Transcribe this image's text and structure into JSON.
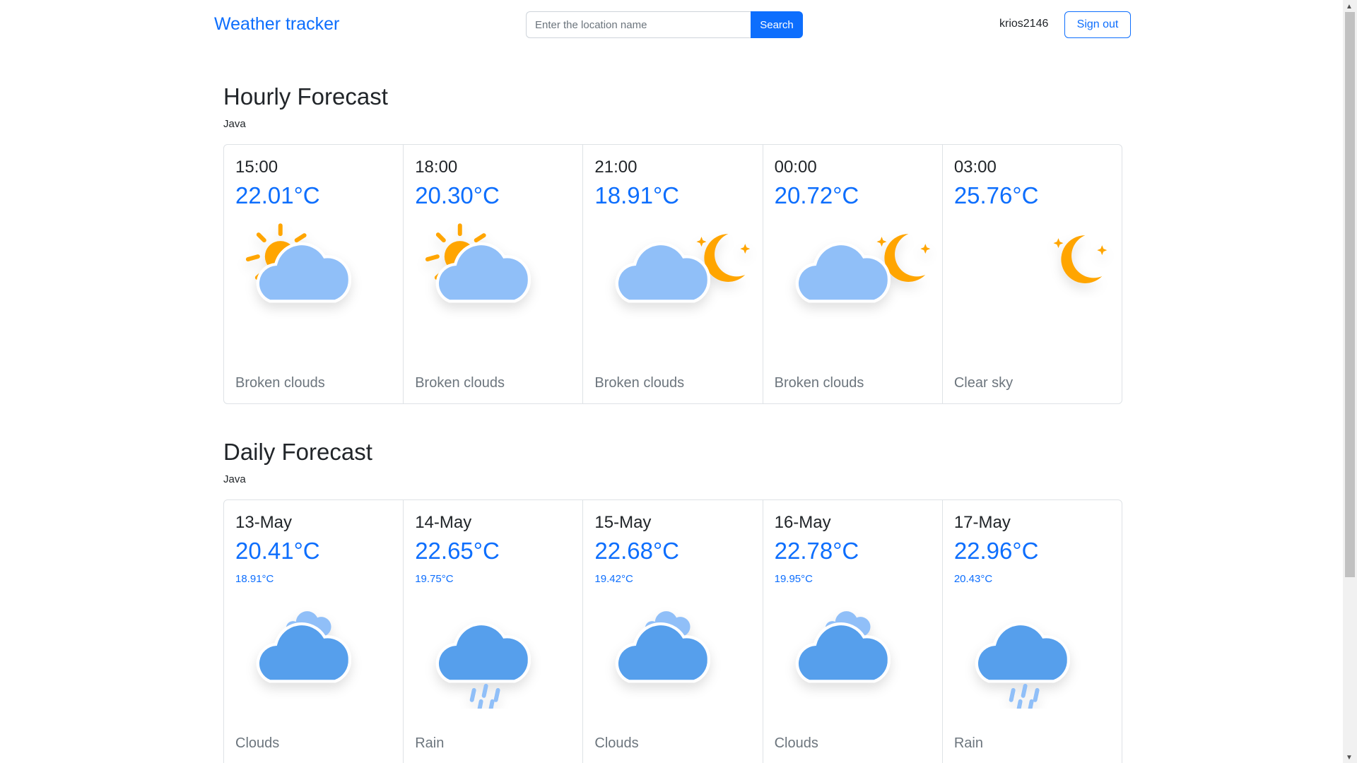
{
  "navbar": {
    "brand": "Weather tracker",
    "search_placeholder": "Enter the location name",
    "search_button": "Search",
    "username": "krios2146",
    "signout_button": "Sign out"
  },
  "hourly": {
    "title": "Hourly Forecast",
    "location": "Java",
    "cards": [
      {
        "time": "15:00",
        "temp": "22.01°C",
        "icon": "broken-clouds-day-icon",
        "desc": "Broken clouds"
      },
      {
        "time": "18:00",
        "temp": "20.30°C",
        "icon": "broken-clouds-day-icon",
        "desc": "Broken clouds"
      },
      {
        "time": "21:00",
        "temp": "18.91°C",
        "icon": "broken-clouds-night-icon",
        "desc": "Broken clouds"
      },
      {
        "time": "00:00",
        "temp": "20.72°C",
        "icon": "broken-clouds-night-icon",
        "desc": "Broken clouds"
      },
      {
        "time": "03:00",
        "temp": "25.76°C",
        "icon": "clear-sky-night-icon",
        "desc": "Clear sky"
      }
    ]
  },
  "daily": {
    "title": "Daily Forecast",
    "location": "Java",
    "cards": [
      {
        "date": "13-May",
        "temp": "20.41°C",
        "min": "18.91°C",
        "icon": "clouds-icon",
        "desc": "Clouds"
      },
      {
        "date": "14-May",
        "temp": "22.65°C",
        "min": "19.75°C",
        "icon": "rain-icon",
        "desc": "Rain"
      },
      {
        "date": "15-May",
        "temp": "22.68°C",
        "min": "19.42°C",
        "icon": "clouds-icon",
        "desc": "Clouds"
      },
      {
        "date": "16-May",
        "temp": "22.78°C",
        "min": "19.95°C",
        "icon": "clouds-icon",
        "desc": "Clouds"
      },
      {
        "date": "17-May",
        "temp": "22.96°C",
        "min": "20.43°C",
        "icon": "rain-icon",
        "desc": "Rain"
      }
    ]
  },
  "colors": {
    "primary": "#0d6efd",
    "sun": "#FFA500",
    "cloud_light": "#90BFF8",
    "cloud_dark": "#569FEC"
  }
}
